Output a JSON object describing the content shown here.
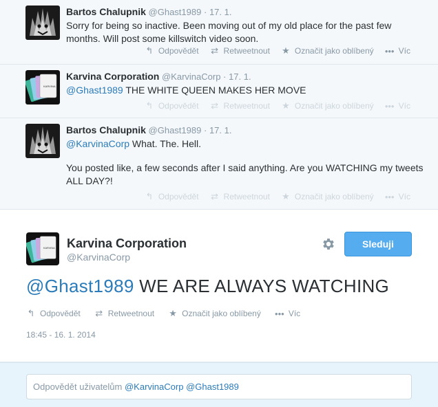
{
  "conversation": [
    {
      "fullname": "Bartos Chalupnik",
      "username": "@Ghast1989",
      "sep": "·",
      "date": "17. 1.",
      "avatar": "demon-avatar",
      "paragraphs": [
        {
          "mention": "",
          "text": "Sorry for being so inactive. Been moving out of my old place for the past few months. Will post some killswitch video soon."
        }
      ],
      "actions_dim": false
    },
    {
      "fullname": "Karvina Corporation",
      "username": "@KarvinaCorp",
      "sep": "·",
      "date": "17. 1.",
      "avatar": "cards-avatar",
      "paragraphs": [
        {
          "mention": "@Ghast1989",
          "text": " THE WHITE QUEEN MAKES HER MOVE"
        }
      ],
      "actions_dim": true
    },
    {
      "fullname": "Bartos Chalupnik",
      "username": "@Ghast1989",
      "sep": "·",
      "date": "17. 1.",
      "avatar": "demon-avatar",
      "paragraphs": [
        {
          "mention": "@KarvinaCorp",
          "text": " What. The. Hell."
        },
        {
          "mention": "",
          "text": "You posted like, a few seconds after I said anything. Are you WATCHING my tweets ALL DAY?!"
        }
      ],
      "actions_dim": true
    }
  ],
  "actions": {
    "reply": "Odpovědět",
    "retweet": "Retweetnout",
    "favorite": "Označit jako oblíbený",
    "more": "Víc"
  },
  "icons": {
    "reply": "reply-arrow-icon",
    "retweet": "retweet-icon",
    "favorite": "star-icon",
    "more": "ellipsis-icon",
    "settings": "gear-icon"
  },
  "main_tweet": {
    "fullname": "Karvina Corporation",
    "username": "@KarvinaCorp",
    "follow_label": "Sleduji",
    "mention": "@Ghast1989",
    "text": " WE ARE ALWAYS WATCHING",
    "timestamp": "18:45 - 16. 1. 2014"
  },
  "reply": {
    "prefix": "Odpovědět uživatelům ",
    "mention1": "@KarvinaCorp",
    "mention2": "@Ghast1989"
  },
  "colors": {
    "link": "#2b7bb9",
    "follow_button": "#55acee",
    "muted": "#8899a6"
  }
}
